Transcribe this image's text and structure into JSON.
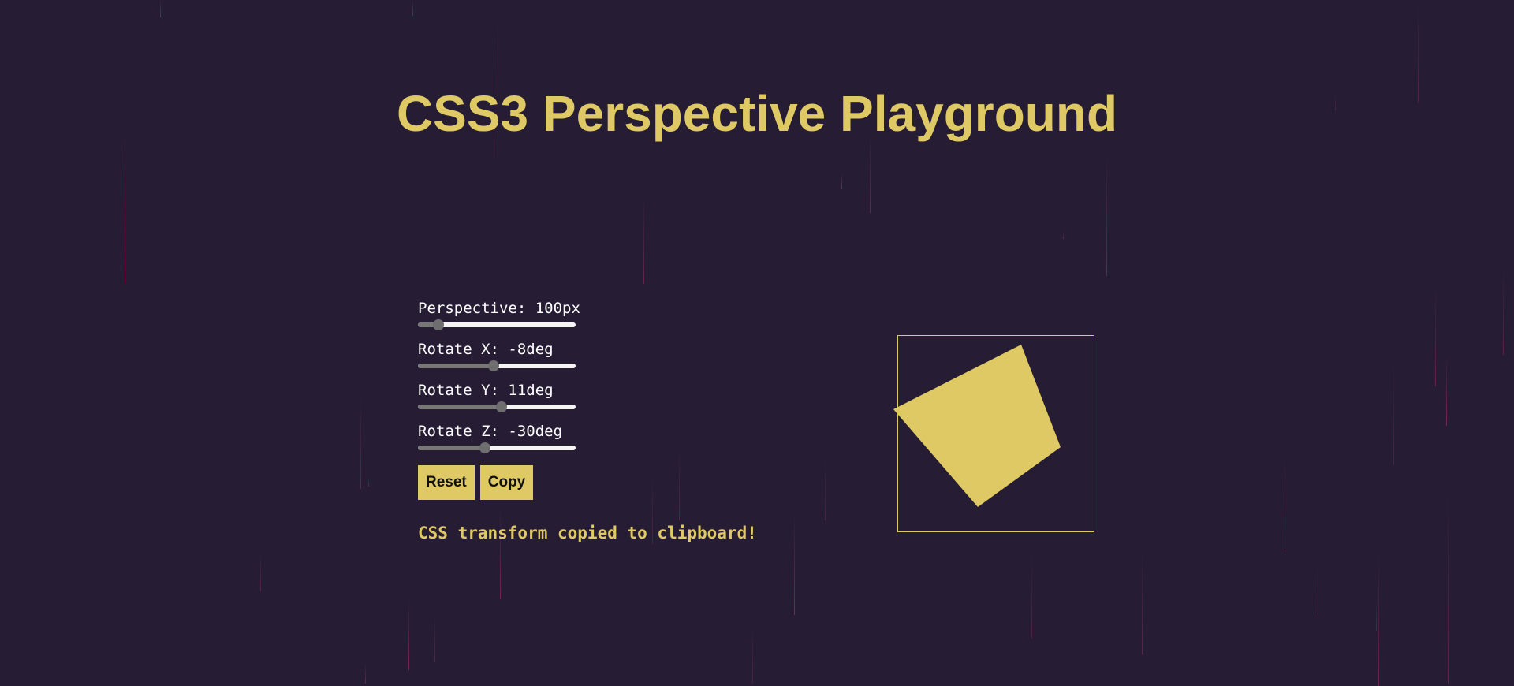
{
  "title": "CSS3 Perspective Playground",
  "colors": {
    "background": "#261d35",
    "accent": "#dfc964",
    "text": "#ffffff",
    "rain": "#c6356b"
  },
  "controls": [
    {
      "name": "perspective",
      "label": "Perspective: 100px",
      "value": 100,
      "min": 0,
      "max": 1000
    },
    {
      "name": "rotate-x",
      "label": "Rotate X: -8deg",
      "value": -8,
      "min": -180,
      "max": 180
    },
    {
      "name": "rotate-y",
      "label": "Rotate Y: 11deg",
      "value": 11,
      "min": -180,
      "max": 180
    },
    {
      "name": "rotate-z",
      "label": "Rotate Z: -30deg",
      "value": -30,
      "min": -180,
      "max": 180
    }
  ],
  "buttons": {
    "reset": "Reset",
    "copy": "Copy"
  },
  "status": "CSS transform copied to clipboard!"
}
